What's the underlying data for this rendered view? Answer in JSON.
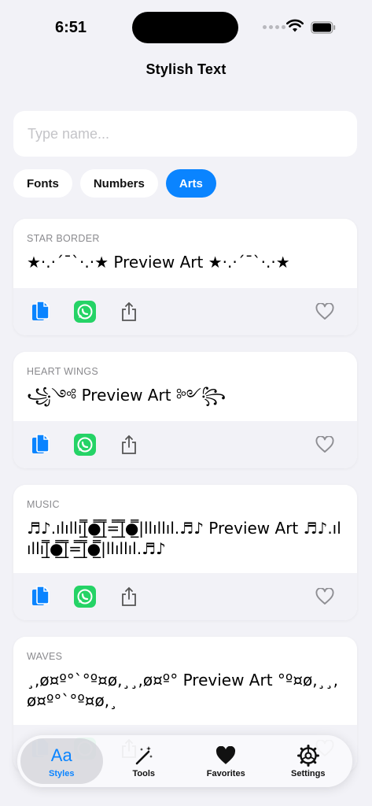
{
  "status": {
    "time": "6:51"
  },
  "header": {
    "title": "Stylish Text"
  },
  "search": {
    "placeholder": "Type name..."
  },
  "chips": [
    {
      "label": "Fonts",
      "active": false
    },
    {
      "label": "Numbers",
      "active": false
    },
    {
      "label": "Arts",
      "active": true
    }
  ],
  "cards": [
    {
      "label": "STAR BORDER",
      "preview": "★·.·´¯`·.·★ Preview Art ★·.·´¯`·.·★"
    },
    {
      "label": "HEART WINGS",
      "preview": "꧁༺ Preview Art ༻꧂"
    },
    {
      "label": "MUSIC",
      "preview": "♬♪.ılıllı|̲̅̅●̲̅̅|̲̅̅=̲̅̅|̲̅̅●̲̅̅|llıllıl.♬♪ Preview Art ♬♪.ılıllı|̲̅̅●̲̅̅|̲̅̅=̲̅̅|̲̅̅●̲̅̅|llıllıl.♬♪"
    },
    {
      "label": "WAVES",
      "preview": "¸,ø¤º°`°º¤ø,¸¸,ø¤º° Preview Art °º¤ø,¸¸,ø¤º°`°º¤ø,¸"
    }
  ],
  "tabs": [
    {
      "label": "Styles",
      "icon": "aa-icon",
      "active": true
    },
    {
      "label": "Tools",
      "icon": "magic-wand-icon",
      "active": false
    },
    {
      "label": "Favorites",
      "icon": "heart-icon",
      "active": false
    },
    {
      "label": "Settings",
      "icon": "gear-icon",
      "active": false
    }
  ],
  "tab_icon_text": "Aa",
  "colors": {
    "accent": "#0a84ff",
    "whatsapp": "#25d366",
    "background": "#f2f2f7"
  }
}
